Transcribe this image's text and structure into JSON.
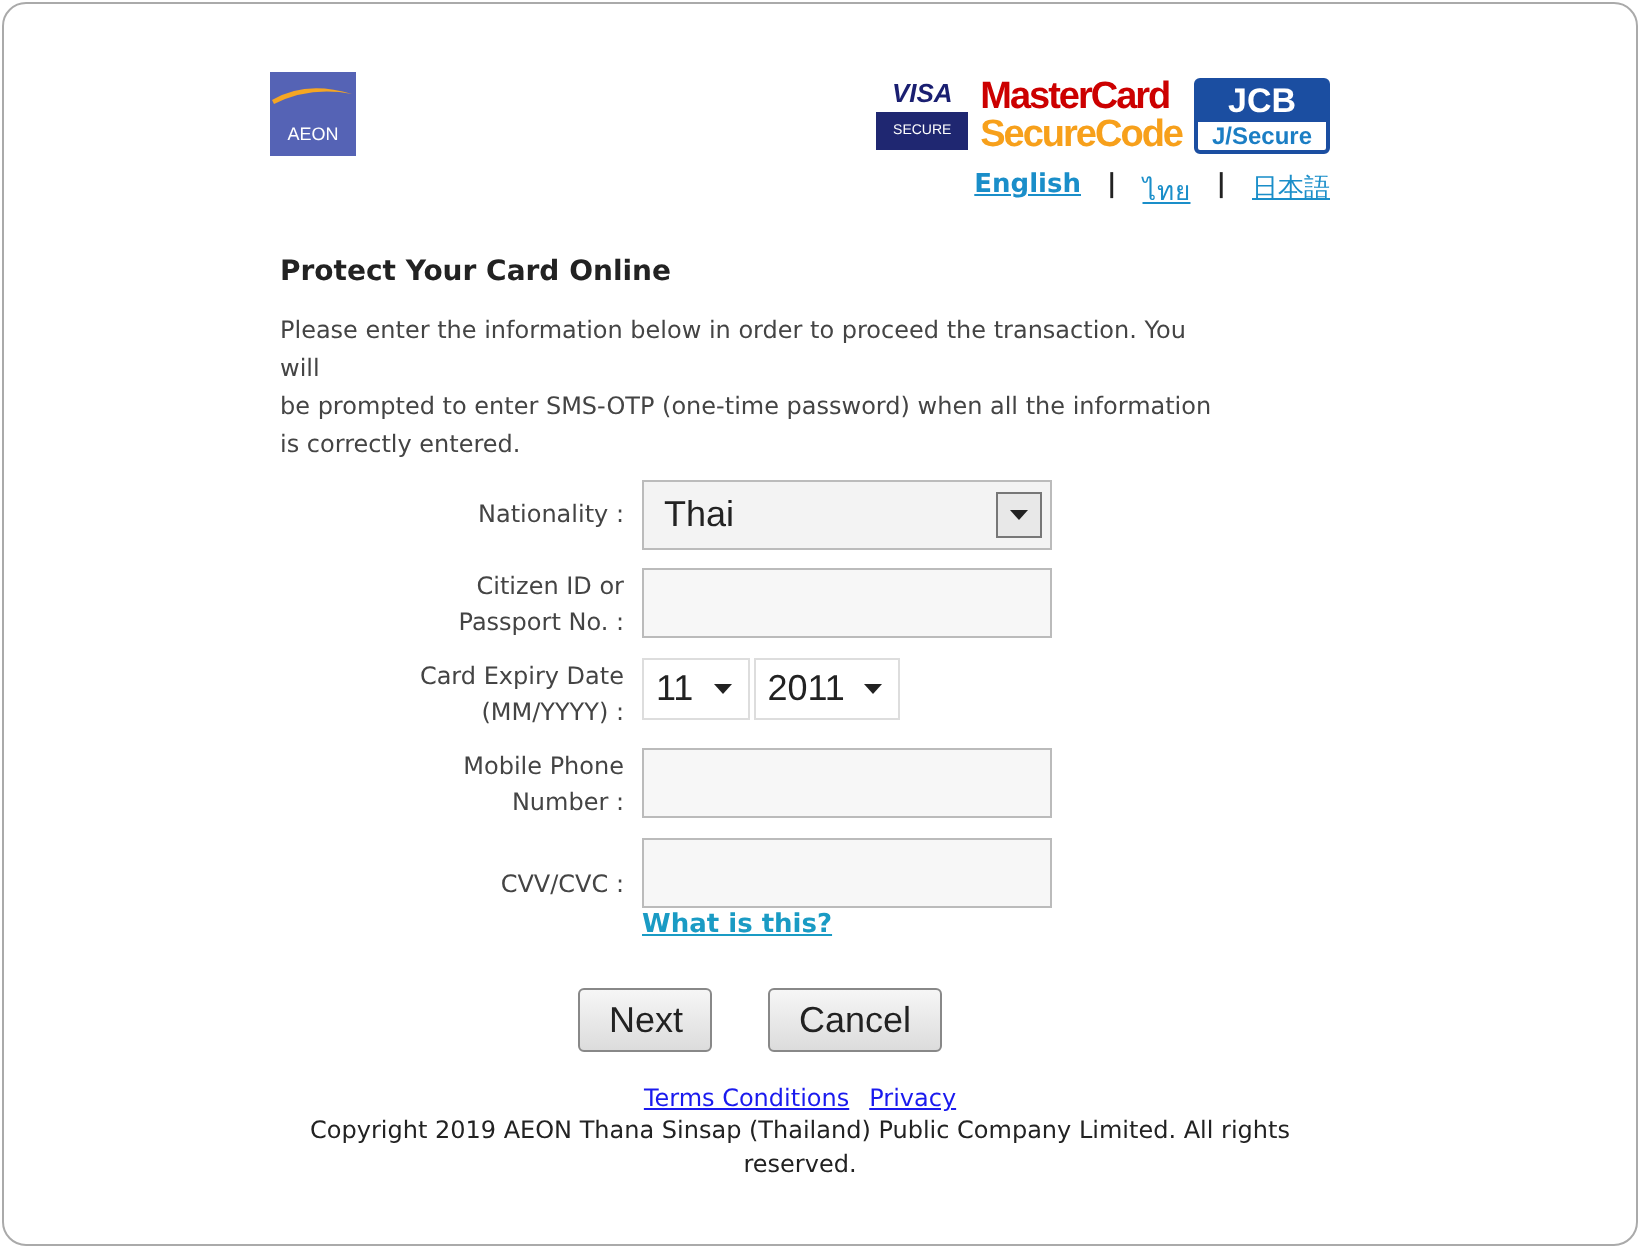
{
  "brand": {
    "logo": "AEON"
  },
  "card_logos": {
    "visa": "VISA",
    "visa_sub": "SECURE",
    "mastercard": "MasterCard",
    "mastercard_sub": "SecureCode",
    "jcb": "JCB",
    "jcb_sub": "J/Secure"
  },
  "language_separator": "|",
  "languages": [
    {
      "label": "English",
      "selected": true
    },
    {
      "label": "ไทย",
      "selected": false
    },
    {
      "label": "日本語",
      "selected": false
    }
  ],
  "heading": "Protect Your Card Online",
  "intro": [
    "Please enter the information below in order to proceed the transaction. You will",
    "be prompted to enter SMS-OTP (one-time password) when all the information is correctly entered."
  ],
  "fields": [
    {
      "kind": "select",
      "label": [
        "Nationality :"
      ],
      "value": "Thai"
    },
    {
      "kind": "text",
      "label": [
        "Citizen ID or",
        "Passport No. :"
      ]
    },
    {
      "kind": "date",
      "label": [
        "Card Expiry Date",
        "(MM/YYYY) :"
      ],
      "month": "11",
      "year": "2011"
    },
    {
      "kind": "text",
      "label": [
        "Mobile Phone",
        "Number :"
      ]
    },
    {
      "kind": "text",
      "label": [
        "CVV/CVC :"
      ],
      "help_link": "What is this?"
    }
  ],
  "buttons": [
    "Next",
    "Cancel"
  ],
  "footer": {
    "links": [
      "Terms Conditions",
      "Privacy"
    ],
    "copyright": "Copyright 2019 AEON Thana Sinsap (Thailand) Public Company Limited. All rights reserved."
  }
}
